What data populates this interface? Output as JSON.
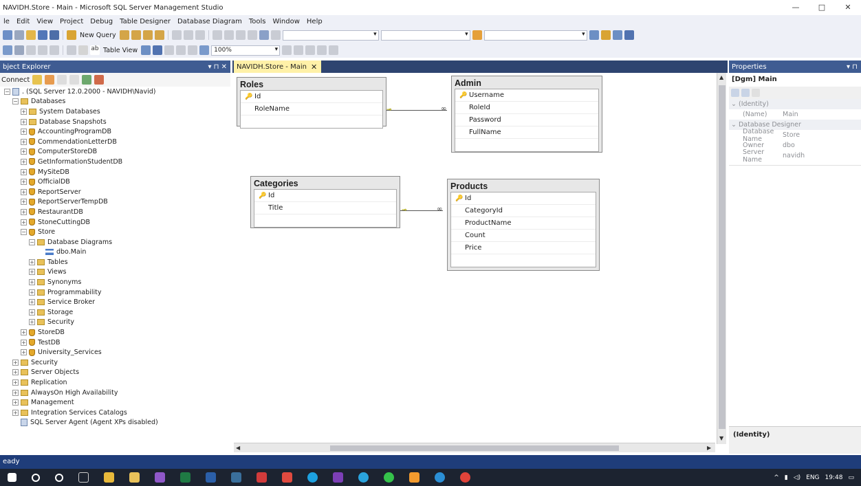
{
  "window": {
    "title": "NAVIDH.Store - Main - Microsoft SQL Server Management Studio",
    "controls": [
      "—",
      "□",
      "✕"
    ]
  },
  "menu": [
    "le",
    "Edit",
    "View",
    "Project",
    "Debug",
    "Table Designer",
    "Database Diagram",
    "Tools",
    "Window",
    "Help"
  ],
  "toolbar": {
    "new_query": "New Query",
    "table_view": "Table View",
    "zoom": "100%"
  },
  "object_explorer": {
    "title": "bject Explorer",
    "pin": "▾ ⊓ ✕",
    "connect_label": "Connect",
    "nodes": [
      {
        "level": 0,
        "exp": "⊟",
        "icon": "server-icon",
        "label": ". (SQL Server 12.0.2000 - NAVIDH\\Navid)"
      },
      {
        "level": 1,
        "exp": "⊟",
        "icon": "folder-icon",
        "label": "Databases"
      },
      {
        "level": 2,
        "exp": "⊞",
        "icon": "folder-icon",
        "label": "System Databases"
      },
      {
        "level": 2,
        "exp": "⊞",
        "icon": "folder-icon",
        "label": "Database Snapshots"
      },
      {
        "level": 2,
        "exp": "⊞",
        "icon": "database-icon",
        "label": "AccountingProgramDB"
      },
      {
        "level": 2,
        "exp": "⊞",
        "icon": "database-icon",
        "label": "CommendationLetterDB"
      },
      {
        "level": 2,
        "exp": "⊞",
        "icon": "database-icon",
        "label": "ComputerStoreDB"
      },
      {
        "level": 2,
        "exp": "⊞",
        "icon": "database-icon",
        "label": "GetInformationStudentDB"
      },
      {
        "level": 2,
        "exp": "⊞",
        "icon": "database-icon",
        "label": "MySiteDB"
      },
      {
        "level": 2,
        "exp": "⊞",
        "icon": "database-icon",
        "label": "OfficialDB"
      },
      {
        "level": 2,
        "exp": "⊞",
        "icon": "database-icon",
        "label": "ReportServer"
      },
      {
        "level": 2,
        "exp": "⊞",
        "icon": "database-icon",
        "label": "ReportServerTempDB"
      },
      {
        "level": 2,
        "exp": "⊞",
        "icon": "database-icon",
        "label": "RestaurantDB"
      },
      {
        "level": 2,
        "exp": "⊞",
        "icon": "database-icon",
        "label": "StoneCuttingDB"
      },
      {
        "level": 2,
        "exp": "⊟",
        "icon": "database-icon",
        "label": "Store"
      },
      {
        "level": 3,
        "exp": "⊟",
        "icon": "folder-icon",
        "label": "Database Diagrams"
      },
      {
        "level": 4,
        "exp": "",
        "icon": "diagram-icon",
        "label": "dbo.Main"
      },
      {
        "level": 3,
        "exp": "⊞",
        "icon": "folder-icon",
        "label": "Tables"
      },
      {
        "level": 3,
        "exp": "⊞",
        "icon": "folder-icon",
        "label": "Views"
      },
      {
        "level": 3,
        "exp": "⊞",
        "icon": "folder-icon",
        "label": "Synonyms"
      },
      {
        "level": 3,
        "exp": "⊞",
        "icon": "folder-icon",
        "label": "Programmability"
      },
      {
        "level": 3,
        "exp": "⊞",
        "icon": "folder-icon",
        "label": "Service Broker"
      },
      {
        "level": 3,
        "exp": "⊞",
        "icon": "folder-icon",
        "label": "Storage"
      },
      {
        "level": 3,
        "exp": "⊞",
        "icon": "folder-icon",
        "label": "Security"
      },
      {
        "level": 2,
        "exp": "⊞",
        "icon": "database-icon",
        "label": "StoreDB"
      },
      {
        "level": 2,
        "exp": "⊞",
        "icon": "database-icon",
        "label": "TestDB"
      },
      {
        "level": 2,
        "exp": "⊞",
        "icon": "database-icon",
        "label": "University_Services"
      },
      {
        "level": 1,
        "exp": "⊞",
        "icon": "folder-icon",
        "label": "Security"
      },
      {
        "level": 1,
        "exp": "⊞",
        "icon": "folder-icon",
        "label": "Server Objects"
      },
      {
        "level": 1,
        "exp": "⊞",
        "icon": "folder-icon",
        "label": "Replication"
      },
      {
        "level": 1,
        "exp": "⊞",
        "icon": "folder-icon",
        "label": "AlwaysOn High Availability"
      },
      {
        "level": 1,
        "exp": "⊞",
        "icon": "folder-icon",
        "label": "Management"
      },
      {
        "level": 1,
        "exp": "⊞",
        "icon": "folder-icon",
        "label": "Integration Services Catalogs"
      },
      {
        "level": 1,
        "exp": "",
        "icon": "agent-icon",
        "label": "SQL Server Agent (Agent XPs disabled)"
      }
    ]
  },
  "document_tab": {
    "label": "NAVIDH.Store - Main",
    "close": "✕"
  },
  "diagram": {
    "tables": {
      "roles": {
        "name": "Roles",
        "columns": [
          {
            "key": true,
            "name": "Id"
          },
          {
            "key": false,
            "name": "RoleName"
          }
        ]
      },
      "admin": {
        "name": "Admin",
        "columns": [
          {
            "key": true,
            "name": "Username"
          },
          {
            "key": false,
            "name": "RoleId"
          },
          {
            "key": false,
            "name": "Password"
          },
          {
            "key": false,
            "name": "FullName"
          }
        ]
      },
      "categories": {
        "name": "Categories",
        "columns": [
          {
            "key": true,
            "name": "Id"
          },
          {
            "key": false,
            "name": "Title"
          }
        ]
      },
      "products": {
        "name": "Products",
        "columns": [
          {
            "key": true,
            "name": "Id"
          },
          {
            "key": false,
            "name": "CategoryId"
          },
          {
            "key": false,
            "name": "ProductName"
          },
          {
            "key": false,
            "name": "Count"
          },
          {
            "key": false,
            "name": "Price"
          }
        ]
      }
    }
  },
  "properties": {
    "title": "Properties",
    "pin": "▾ ⊓",
    "object": "[Dgm] Main",
    "groups": [
      {
        "category": "(Identity)",
        "rows": [
          {
            "name": "(Name)",
            "value": "Main"
          }
        ]
      },
      {
        "category": "Database Designer",
        "rows": [
          {
            "name": "Database Name",
            "value": "Store"
          },
          {
            "name": "Owner",
            "value": "dbo"
          },
          {
            "name": "Server Name",
            "value": "navidh"
          }
        ]
      }
    ],
    "description": "(Identity)"
  },
  "status": {
    "text": "eady"
  },
  "taskbar": {
    "tray_lang": "ENG",
    "clock": "19:48"
  },
  "colors": {
    "panel_header": "#3f5c92",
    "tab_active": "#fff1a8",
    "status_bar": "#1f3d7a",
    "taskbar": "#1c2330"
  }
}
